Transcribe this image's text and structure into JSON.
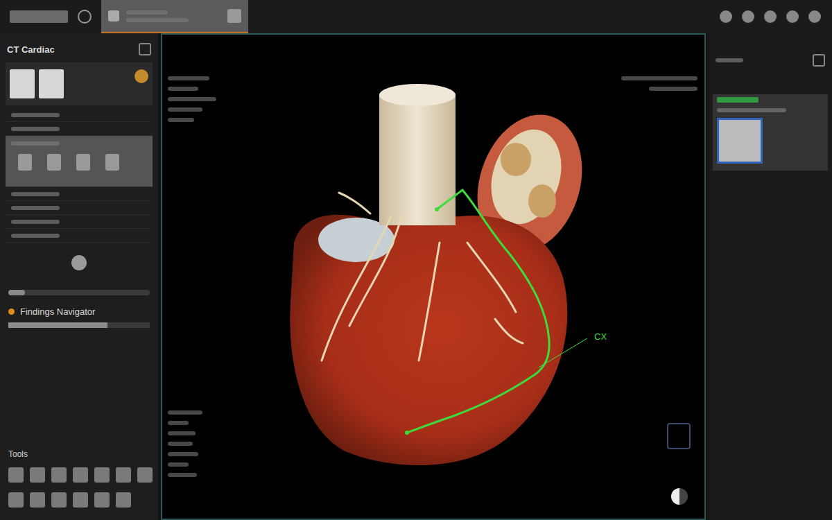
{
  "top_bar": {
    "tabs": [
      {
        "selected": true
      }
    ]
  },
  "left_panel": {
    "title": "CT Cardiac",
    "sections": [
      {
        "selected": false
      },
      {
        "selected": false
      },
      {
        "selected": true
      },
      {
        "selected": false
      },
      {
        "selected": false
      },
      {
        "selected": false
      },
      {
        "selected": false
      }
    ],
    "slider": {
      "level": 0.12
    },
    "findings_navigator": {
      "label": "Findings Navigator",
      "level": 0.7
    },
    "tools": {
      "label": "Tools"
    }
  },
  "viewport": {
    "annotations": [
      {
        "label": "CX",
        "color": "#3ddc3d"
      }
    ]
  },
  "right_panel": {
    "series": [
      {
        "selected": true
      }
    ]
  }
}
